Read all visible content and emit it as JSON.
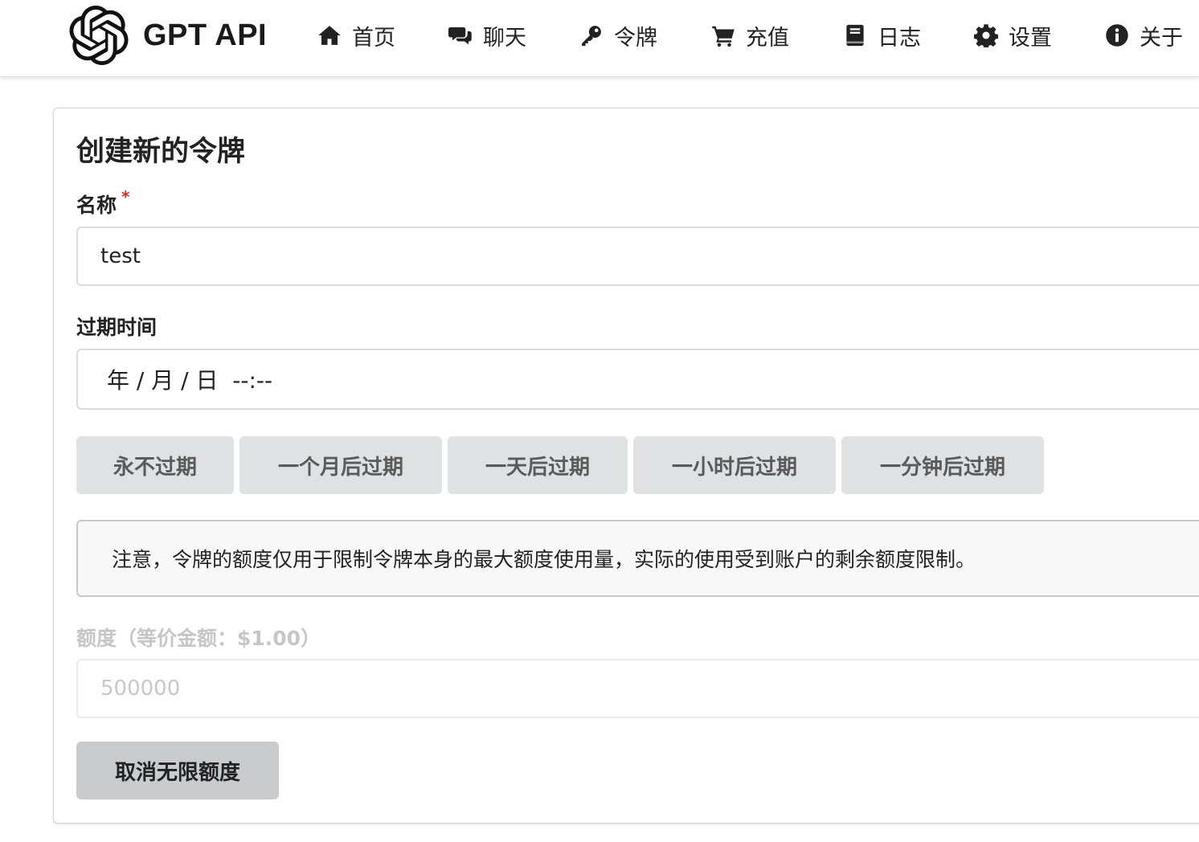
{
  "navbar": {
    "brand": "GPT API",
    "items": [
      {
        "label": "首页",
        "icon": "home-icon"
      },
      {
        "label": "聊天",
        "icon": "comments-icon"
      },
      {
        "label": "令牌",
        "icon": "key-icon"
      },
      {
        "label": "充值",
        "icon": "cart-icon"
      },
      {
        "label": "日志",
        "icon": "book-icon"
      },
      {
        "label": "设置",
        "icon": "gear-icon"
      },
      {
        "label": "关于",
        "icon": "info-icon"
      }
    ]
  },
  "form": {
    "title": "创建新的令牌",
    "name_label": "名称",
    "required_mark": "*",
    "name_value": "test",
    "expire_label": "过期时间",
    "expire_value": "年 / 月 / 日  --:--",
    "presets": [
      "永不过期",
      "一个月后过期",
      "一天后过期",
      "一小时后过期",
      "一分钟后过期"
    ],
    "notice": "注意，令牌的额度仅用于限制令牌本身的最大额度使用量，实际的使用受到账户的剩余额度限制。",
    "quota_label": "额度（等价金额：$1.00）",
    "quota_placeholder": "500000",
    "cancel_unlimited_label": "取消无限额度"
  },
  "colors": {
    "nav_bg": "#ffffff",
    "button_grey": "#e0e1e2",
    "button_dark_grey": "#cacbcd",
    "required_red": "#db2828",
    "notice_bg": "#f8f8f9"
  }
}
